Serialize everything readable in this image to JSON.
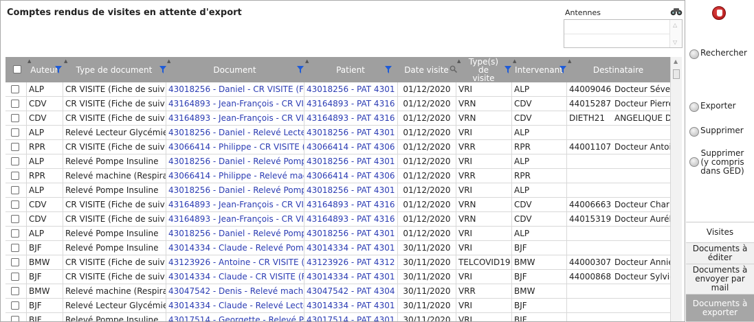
{
  "page": {
    "title": "Comptes rendus de visites en attente d'export"
  },
  "antennes": {
    "label": "Antennes"
  },
  "grid": {
    "headers": {
      "auteur": "Auteur",
      "type_document": "Type de document",
      "document": "Document",
      "patient": "Patient",
      "date_visite": "Date visite",
      "types_visite": "Type(s) de visite",
      "intervenant": "Intervenant",
      "destinataire": "Destinataire"
    },
    "rows": [
      {
        "auteur": "ALP",
        "type": "CR VISITE (Fiche de suiv",
        "document": "43018256 - Daniel - CR VISITE (F",
        "patient": "43018256 - PAT 4301",
        "date": "01/12/2020",
        "visite": "VRI",
        "intervenant": "ALP",
        "dest_code": "44009046",
        "dest_name": "Docteur Séve"
      },
      {
        "auteur": "CDV",
        "type": "CR VISITE (Fiche de suiv",
        "document": "43164893 - Jean-François - CR VI",
        "patient": "43164893 - PAT 4316",
        "date": "01/12/2020",
        "visite": "VRN",
        "intervenant": "CDV",
        "dest_code": "44015287",
        "dest_name": "Docteur Pierre"
      },
      {
        "auteur": "CDV",
        "type": "CR VISITE (Fiche de suiv",
        "document": "43164893 - Jean-François - CR VI",
        "patient": "43164893 - PAT 4316",
        "date": "01/12/2020",
        "visite": "VRN",
        "intervenant": "CDV",
        "dest_code": "DIETH21",
        "dest_name": "ANGELIQUE DI"
      },
      {
        "auteur": "ALP",
        "type": "Relevé Lecteur Glycémie",
        "document": "43018256 - Daniel - Relevé Lecteu",
        "patient": "43018256 - PAT 4301",
        "date": "01/12/2020",
        "visite": "VRI",
        "intervenant": "ALP",
        "dest_code": "",
        "dest_name": ""
      },
      {
        "auteur": "RPR",
        "type": "CR VISITE (Fiche de suiv",
        "document": "43066414 - Philippe - CR VISITE (",
        "patient": "43066414 - PAT 4306",
        "date": "01/12/2020",
        "visite": "VRR",
        "intervenant": "RPR",
        "dest_code": "44001107",
        "dest_name": "Docteur Antoi"
      },
      {
        "auteur": "ALP",
        "type": "Relevé Pompe Insuline",
        "document": "43018256 - Daniel - Relevé Pompe",
        "patient": "43018256 - PAT 4301",
        "date": "01/12/2020",
        "visite": "VRI",
        "intervenant": "ALP",
        "dest_code": "",
        "dest_name": ""
      },
      {
        "auteur": "RPR",
        "type": "Relevé machine (Respirat",
        "document": "43066414 - Philippe - Relevé mach",
        "patient": "43066414 - PAT 4306",
        "date": "01/12/2020",
        "visite": "VRR",
        "intervenant": "RPR",
        "dest_code": "",
        "dest_name": ""
      },
      {
        "auteur": "ALP",
        "type": "Relevé Pompe Insuline",
        "document": "43018256 - Daniel - Relevé Pompe",
        "patient": "43018256 - PAT 4301",
        "date": "01/12/2020",
        "visite": "VRI",
        "intervenant": "ALP",
        "dest_code": "",
        "dest_name": ""
      },
      {
        "auteur": "CDV",
        "type": "CR VISITE (Fiche de suiv",
        "document": "43164893 - Jean-François - CR VI",
        "patient": "43164893 - PAT 4316",
        "date": "01/12/2020",
        "visite": "VRN",
        "intervenant": "CDV",
        "dest_code": "44006663",
        "dest_name": "Docteur Charl"
      },
      {
        "auteur": "CDV",
        "type": "CR VISITE (Fiche de suiv",
        "document": "43164893 - Jean-François - CR VI",
        "patient": "43164893 - PAT 4316",
        "date": "01/12/2020",
        "visite": "VRN",
        "intervenant": "CDV",
        "dest_code": "44015319",
        "dest_name": "Docteur Aurél"
      },
      {
        "auteur": "ALP",
        "type": "Relevé Pompe Insuline",
        "document": "43018256 - Daniel - Relevé Pompe",
        "patient": "43018256 - PAT 4301",
        "date": "01/12/2020",
        "visite": "VRI",
        "intervenant": "ALP",
        "dest_code": "",
        "dest_name": ""
      },
      {
        "auteur": "BJF",
        "type": "Relevé Pompe Insuline",
        "document": "43014334 - Claude - Relevé Pomp",
        "patient": "43014334 - PAT 4301",
        "date": "30/11/2020",
        "visite": "VRI",
        "intervenant": "BJF",
        "dest_code": "",
        "dest_name": ""
      },
      {
        "auteur": "BMW",
        "type": "CR VISITE (Fiche de suiv",
        "document": "43123926 - Antoine - CR VISITE (",
        "patient": "43123926 - PAT 4312",
        "date": "30/11/2020",
        "visite": "TELCOVID19",
        "intervenant": "BMW",
        "dest_code": "44000307",
        "dest_name": "Docteur Annie"
      },
      {
        "auteur": "BJF",
        "type": "CR VISITE (Fiche de suiv",
        "document": "43014334 - Claude - CR VISITE (F",
        "patient": "43014334 - PAT 4301",
        "date": "30/11/2020",
        "visite": "VRI",
        "intervenant": "BJF",
        "dest_code": "44000868",
        "dest_name": "Docteur Sylvie"
      },
      {
        "auteur": "BMW",
        "type": "Relevé machine (Respirat",
        "document": "43047542 - Denis - Relevé machir",
        "patient": "43047542 - PAT 4304",
        "date": "30/11/2020",
        "visite": "VRR",
        "intervenant": "BMW",
        "dest_code": "",
        "dest_name": ""
      },
      {
        "auteur": "BJF",
        "type": "Relevé Lecteur Glycémie",
        "document": "43014334 - Claude - Relevé Lecte",
        "patient": "43014334 - PAT 4301",
        "date": "30/11/2020",
        "visite": "VRI",
        "intervenant": "BJF",
        "dest_code": "",
        "dest_name": ""
      },
      {
        "auteur": "BJF",
        "type": "Relevé Pompe Insuline",
        "document": "43017514 - Georgette - Relevé Po",
        "patient": "43017514 - PAT 4301",
        "date": "30/11/2020",
        "visite": "VRI",
        "intervenant": "BJF",
        "dest_code": "",
        "dest_name": ""
      }
    ]
  },
  "actions": {
    "rechercher": "Rechercher",
    "exporter": "Exporter",
    "supprimer": "Supprimer",
    "supprimer_ged": "Supprimer (y compris dans GED)"
  },
  "nav": {
    "visites": "Visites",
    "documents_editer": "Documents à éditer",
    "documents_mail": "Documents à envoyer par mail",
    "documents_exporter": "Documents à exporter"
  },
  "icons": {
    "stop": "stop-hand-icon",
    "binoculars": "binoculars-icon",
    "filter": "filter-icon",
    "magnifier": "magnifier-icon"
  }
}
